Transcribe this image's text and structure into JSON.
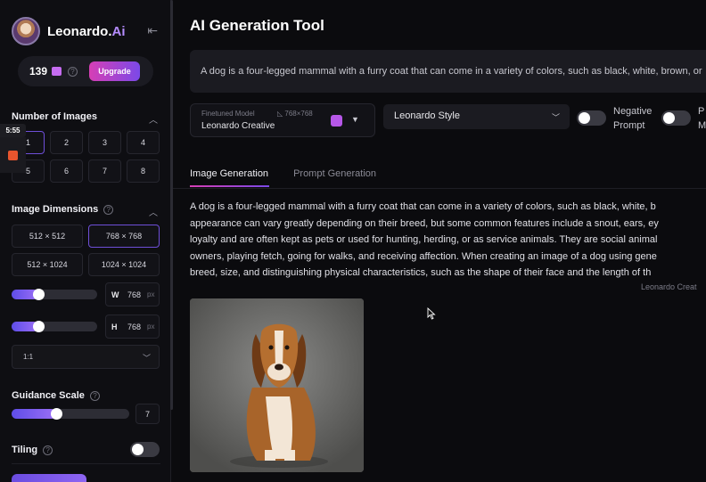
{
  "sidebar": {
    "brand_main": "Leonardo.",
    "brand_ai": "Ai",
    "tokens": "139",
    "upgrade_label": "Upgrade",
    "num_images_title": "Number of Images",
    "num_options": [
      "1",
      "2",
      "3",
      "4",
      "5",
      "6",
      "7",
      "8"
    ],
    "num_selected": "1",
    "dimensions_title": "Image Dimensions",
    "dimension_options": [
      "512 × 512",
      "768 × 768",
      "512 × 1024",
      "1024 × 1024"
    ],
    "dimension_selected": "768 × 768",
    "width_label": "W",
    "width_value": "768",
    "height_label": "H",
    "height_value": "768",
    "unit": "px",
    "aspect_ratio": "1:1",
    "guidance_title": "Guidance Scale",
    "guidance_value": "7",
    "tiling_title": "Tiling",
    "tiling_enabled": false
  },
  "overlay": {
    "timer": "5:55"
  },
  "main": {
    "title": "AI Generation Tool",
    "prompt": "A dog is a four-legged mammal with a furry coat that can come in a variety of colors, such as black, white, brown, or",
    "model_caption": "Finetuned Model",
    "model_dims": "768×768",
    "model_name": "Leonardo Creative",
    "style": "Leonardo Style",
    "negative_prompt_label_1": "Negative",
    "negative_prompt_label_2": "Prompt",
    "negative_prompt_enabled": false,
    "extra_toggle_label_1": "P",
    "extra_toggle_label_2": "M",
    "extra_toggle_enabled": false,
    "tabs": [
      {
        "label": "Image Generation",
        "active": true
      },
      {
        "label": "Prompt Generation",
        "active": false
      }
    ],
    "description_lines": [
      "A dog is a four-legged mammal with a furry coat that can come in a variety of colors, such as black, white, b",
      "appearance can vary greatly depending on their breed, but some common features include a snout, ears, ey",
      "loyalty and are often kept as pets or used for hunting, herding, or as service animals. They are social animal",
      "owners, playing fetch, going for walks, and receiving affection. When creating an image of a dog using gene",
      "breed, size, and distinguishing physical characteristics, such as the shape of their face and the length of th"
    ],
    "model_credit": "Leonardo Creat"
  },
  "colors": {
    "accent_start": "#d63fb5",
    "accent_end": "#7b49e8",
    "slider": "#7b5cf0",
    "background": "#0b0b0e"
  },
  "icons": {
    "collapse": "collapse-sidebar-icon",
    "token": "token-icon",
    "help": "help-circle-icon",
    "chevron_up": "chevron-up-icon",
    "chevron_down": "chevron-down-icon",
    "model": "model-badge-icon",
    "cursor": "mouse-cursor-icon"
  },
  "sliders": {
    "width_fraction": 0.25,
    "height_fraction": 0.25,
    "guidance_fraction": 0.33
  }
}
